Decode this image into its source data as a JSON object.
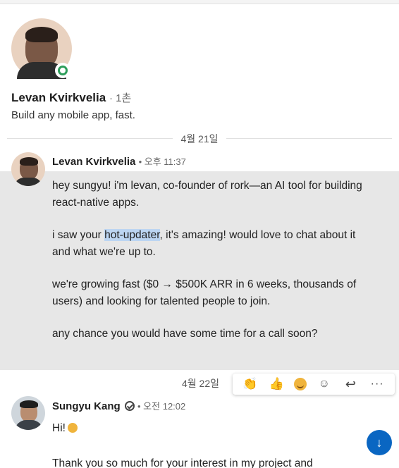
{
  "profile": {
    "name": "Levan Kvirkvelia",
    "degree": "· 1촌",
    "headline": "Build any mobile app, fast."
  },
  "conversation": {
    "date_1": "4월 21일",
    "message_1": {
      "sender": "Levan Kvirkvelia",
      "meta": "• 오후 11:37",
      "p1": "hey sungyu! i'm levan, co-founder of rork—an AI tool for building react-native apps.",
      "p2_before": "i saw your ",
      "p2_highlight": "hot-updater",
      "p2_after": ", it's amazing! would love to chat about it and what we're up to.",
      "p3": "we're growing fast ($0 → $500K ARR in 6 weeks, thousands of users) and looking for talented people to join.",
      "p4": "any chance you would have some time for a call soon?"
    },
    "date_2": "4월 22일",
    "reactions": {
      "celebrate": "celebrate-icon",
      "like": "thumbs-up-icon",
      "smile": "smile-emoji-icon",
      "add_emoji": "add-emoji-icon",
      "reply": "reply-icon",
      "more": "more-icon",
      "celebrate_glyph": "👏",
      "like_glyph": "👍",
      "add_emoji_glyph": "☺",
      "reply_glyph": "↩",
      "more_glyph": "···"
    },
    "message_2": {
      "sender": "Sungyu Kang",
      "meta": "• 오전 12:02",
      "p1": "Hi!",
      "p2": "Thank you so much for your interest in my project and"
    }
  },
  "scroll_button_glyph": "↓",
  "colors": {
    "accent": "#0a66c2",
    "online": "#2e9e5b",
    "highlight": "#bcd5f2",
    "selected_message_bg": "#e7e7e7"
  }
}
